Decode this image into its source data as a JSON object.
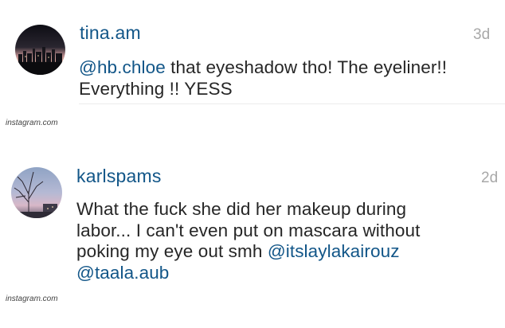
{
  "comments": [
    {
      "username": "tina.am",
      "time": "3d",
      "mention": "@hb.chloe",
      "text_line1": " that eyeshadow tho! The eyeliner!!",
      "text_line2": "Everything !! YESS",
      "avatar_icon": "city-skyline-sunset-avatar"
    },
    {
      "username": "karlspams",
      "time": "2d",
      "text_line1": "What the fuck she did her makeup during",
      "text_line2": "labor... I can't even put on mascara without",
      "text_line3": "poking my eye out smh ",
      "mention1": "@itslaylakairouz",
      "mention2": "@taala.aub",
      "avatar_icon": "bare-tree-sky-avatar"
    }
  ],
  "watermark": "instagram.com",
  "colors": {
    "link": "#125688",
    "text": "#262626",
    "timestamp": "#a8a8a8"
  }
}
